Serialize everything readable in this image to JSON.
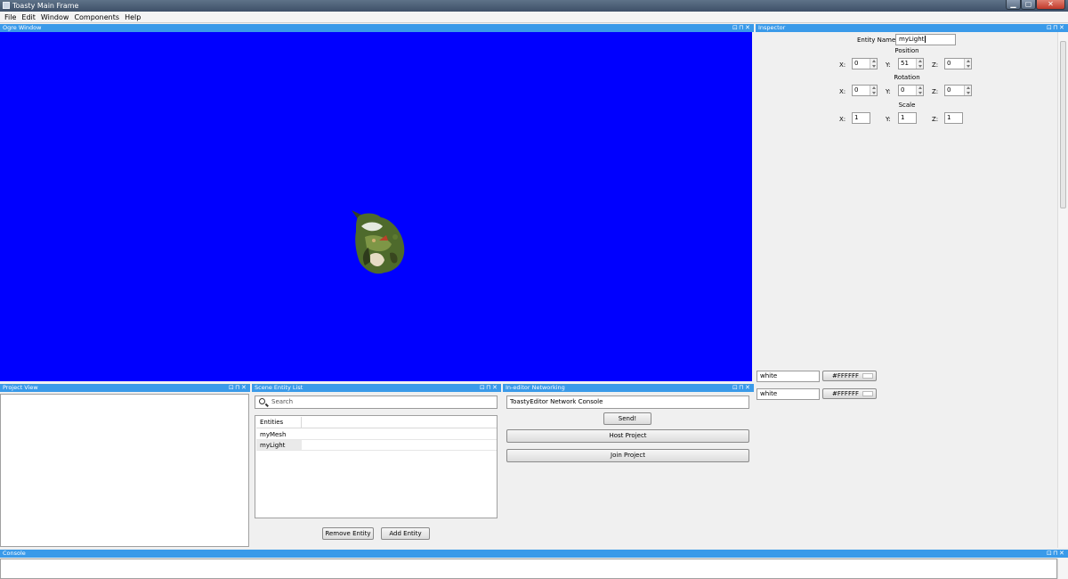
{
  "window": {
    "title": "Toasty Main Frame",
    "controls": {
      "minimize": "▁",
      "maximize": "▢",
      "close": "✕"
    }
  },
  "menu": [
    "File",
    "Edit",
    "Window",
    "Components",
    "Help"
  ],
  "panel_controls": {
    "restore": "⊡",
    "pin": "⊓",
    "close": "✕"
  },
  "ogre_window": {
    "title": "Ogre Window",
    "background_color": "#0000FF"
  },
  "inspector": {
    "title": "Inspector",
    "entity_name_label": "Entity Name:",
    "entity_name_value": "myLight",
    "position": {
      "label": "Position",
      "x_label": "X:",
      "y_label": "Y:",
      "z_label": "Z:",
      "x": "0",
      "y": "51",
      "z": "0"
    },
    "rotation": {
      "label": "Rotation",
      "x_label": "X:",
      "y_label": "Y:",
      "z_label": "Z:",
      "x": "0",
      "y": "0",
      "z": "0"
    },
    "scale": {
      "label": "Scale",
      "x_label": "X:",
      "y_label": "Y:",
      "z_label": "Z:",
      "x": "1",
      "y": "1",
      "z": "1"
    },
    "colors": [
      {
        "name": "white",
        "hex": "#FFFFFF"
      },
      {
        "name": "white",
        "hex": "#FFFFFF"
      }
    ]
  },
  "project_view": {
    "title": "Project View"
  },
  "scene_entity_list": {
    "title": "Scene Entity List",
    "search_placeholder": "Search",
    "column_header": "Entities",
    "entities": [
      "myMesh",
      "myLight"
    ],
    "remove_button": "Remove Entity",
    "add_button": "Add Entity"
  },
  "networking": {
    "title": "In-editor Networking",
    "console_text": "ToastyEditor Network Console",
    "send_button": "Send!",
    "host_button": "Host Project",
    "join_button": "Join Project"
  },
  "console": {
    "title": "Console"
  }
}
